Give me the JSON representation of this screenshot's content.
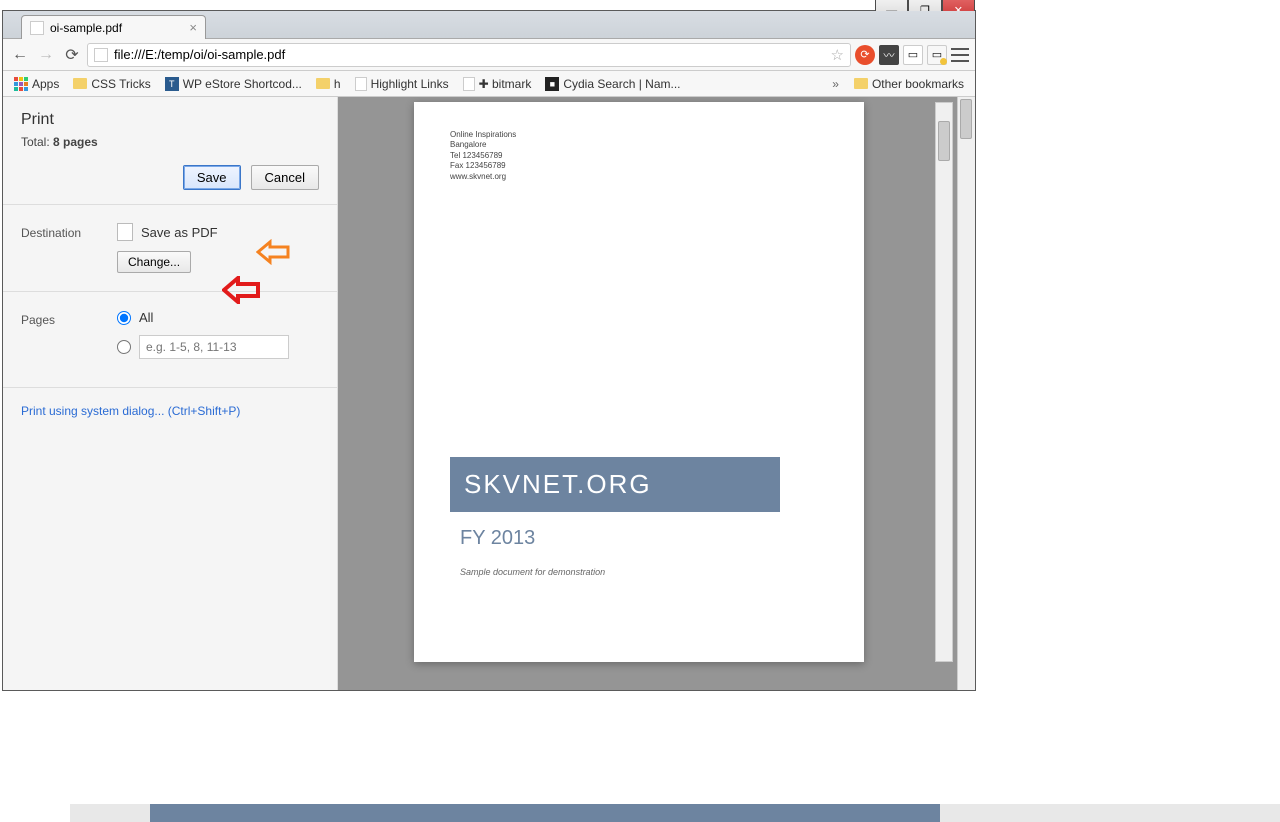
{
  "window_controls": {
    "min": "—",
    "max": "❐",
    "close": "✕"
  },
  "tab": {
    "title": "oi-sample.pdf",
    "close": "×"
  },
  "nav": {
    "back": "←",
    "forward": "→",
    "reload": "⟳"
  },
  "url": "file:///E:/temp/oi/oi-sample.pdf",
  "star": "☆",
  "bookmarks": {
    "apps": "Apps",
    "items": [
      "CSS Tricks",
      "WP eStore Shortcod...",
      "h",
      "Highlight Links",
      "✚ bitmark",
      "Cydia Search | Nam..."
    ],
    "chevrons": "»",
    "other": "Other bookmarks"
  },
  "print": {
    "title": "Print",
    "total_label": "Total: ",
    "total_value": "8 pages",
    "save": "Save",
    "cancel": "Cancel",
    "destination_label": "Destination",
    "destination_value": "Save as PDF",
    "change": "Change...",
    "pages_label": "Pages",
    "pages_all": "All",
    "pages_example": "e.g. 1-5, 8, 11-13",
    "sys_dialog": "Print using system dialog... (Ctrl+Shift+P)"
  },
  "preview": {
    "header": [
      "Online Inspirations",
      "Bangalore",
      "Tel 123456789",
      "Fax 123456789",
      "www.skvnet.org"
    ],
    "banner": "SKVNET.ORG",
    "subtitle": "FY 2013",
    "desc": "Sample document for demonstration"
  }
}
